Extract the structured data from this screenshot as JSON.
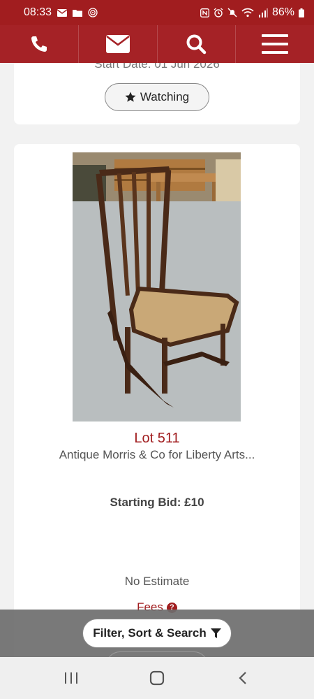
{
  "status_bar": {
    "time": "08:33",
    "battery": "86%"
  },
  "nav": {
    "items": [
      {
        "name": "phone-icon"
      },
      {
        "name": "mail-icon"
      },
      {
        "name": "search-icon"
      },
      {
        "name": "menu-icon"
      }
    ]
  },
  "prev_lot": {
    "start_date": "Start Date: 01 Jun 2026",
    "watching_label": "Watching"
  },
  "lot": {
    "title": "Lot 511",
    "description": "Antique Morris & Co for Liberty Arts...",
    "starting_bid": "Starting Bid: £10",
    "estimate": "No Estimate",
    "fees_label": "Fees"
  },
  "filter": {
    "label": "Filter, Sort & Search"
  },
  "colors": {
    "brand": "#a11d1f",
    "nav": "#a52226"
  }
}
